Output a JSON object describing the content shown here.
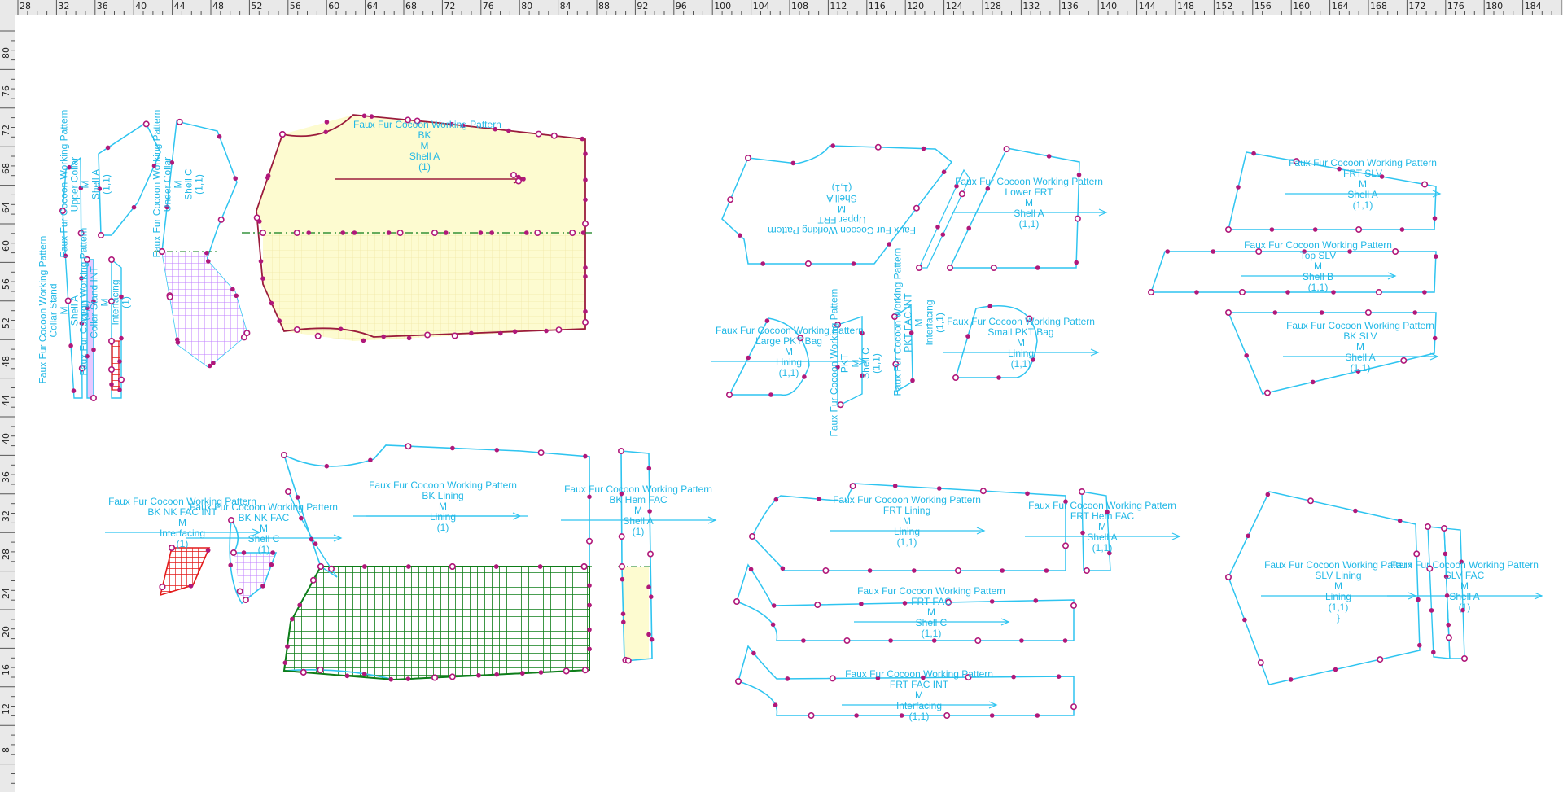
{
  "colors": {
    "outline": "#2ec4f0",
    "outline_shell": "#9b1c3c",
    "point": "#b0187a",
    "label": "#21b8e6",
    "yellow_fill": "#fdfbd0",
    "lavender_fill": "#e6c8ff",
    "green_grid": "#0e7d18",
    "red_grid": "#e31b1b",
    "ruler_bg": "#e9e9e9"
  },
  "ruler": {
    "top_labels": [
      "28",
      "32",
      "36",
      "40",
      "44",
      "48",
      "52",
      "56",
      "60",
      "64",
      "68",
      "72",
      "76",
      "80",
      "84",
      "88",
      "92",
      "96",
      "100",
      "104",
      "108",
      "112",
      "116",
      "120",
      "124",
      "128",
      "132",
      "136",
      "140",
      "144",
      "148",
      "152",
      "156",
      "160",
      "164",
      "168",
      "172",
      "176",
      "180",
      "184"
    ],
    "left_labels": [
      "80",
      "76",
      "72",
      "68",
      "64",
      "60",
      "56",
      "52",
      "48",
      "44",
      "40",
      "36",
      "32",
      "28",
      "24",
      "20",
      "16",
      "12",
      "8"
    ]
  },
  "pieces": [
    {
      "id": "bk",
      "lines": [
        "Faux Fur Cocoon Working Pattern",
        "BK",
        "M",
        "Shell A",
        "(1)"
      ]
    },
    {
      "id": "upper-frt",
      "lines": [
        "Faux Fur Cocoon Working Pattern",
        "Upper FRT",
        "M",
        "Shell A",
        "(1,1)"
      ]
    },
    {
      "id": "lower-frt",
      "lines": [
        "Faux Fur Cocoon Working Pattern",
        "Lower FRT",
        "M",
        "Shell A",
        "(1,1)"
      ]
    },
    {
      "id": "frt-slv",
      "lines": [
        "Faux Fur Cocoon Working Pattern",
        "FRT SLV",
        "M",
        "Shell A",
        "(1,1)"
      ]
    },
    {
      "id": "top-slv",
      "lines": [
        "Faux Fur Cocoon Working Pattern",
        "Top SLV",
        "M",
        "Shell B",
        "(1,1)"
      ]
    },
    {
      "id": "bk-slv",
      "lines": [
        "Faux Fur Cocoon Working Pattern",
        "BK SLV",
        "M",
        "Shell A",
        "(1,1)"
      ]
    },
    {
      "id": "large-pkt-bag",
      "lines": [
        "Faux Fur Cocoon Working Pattern",
        "Large PKT Bag",
        "M",
        "Lining",
        "(1,1)"
      ]
    },
    {
      "id": "small-pkt-bag",
      "lines": [
        "Faux Fur Cocoon Working Pattern",
        "Small PKT Bag",
        "M",
        "Lining",
        "(1,1)"
      ]
    },
    {
      "id": "pkt-welt",
      "lines": [
        "Faux Fur Cocoon Working Pattern",
        "PKT",
        "M",
        "Shell C",
        "(1,1)"
      ]
    },
    {
      "id": "pkt-fac-int",
      "lines": [
        "Faux Fur Cocoon Working Pattern",
        "PKT FAC INT",
        "M",
        "Interfacing",
        "(1,1)"
      ]
    },
    {
      "id": "collar-stand",
      "lines": [
        "Faux Fur Cocoon Working Pattern",
        "Collar Stand",
        "M",
        "Shell A",
        "(1,1)"
      ]
    },
    {
      "id": "upper-collar",
      "lines": [
        "Faux Fur Cocoon Working Pattern",
        "Upper Collar",
        "M",
        "Shell A",
        "(1,1)"
      ]
    },
    {
      "id": "collar-stand-int",
      "lines": [
        "Faux Fur Cocoon Working Pattern",
        "Collar Stand INT",
        "M",
        "Interfacing",
        "(1)"
      ]
    },
    {
      "id": "under-collar",
      "lines": [
        "Faux Fur Cocoon Working Pattern",
        "Under Collar",
        "M",
        "Shell C",
        "(1,1)"
      ]
    },
    {
      "id": "bk-lining",
      "lines": [
        "Faux Fur Cocoon Working Pattern",
        "BK Lining",
        "M",
        "Lining",
        "(1)"
      ]
    },
    {
      "id": "bk-hem-fac",
      "lines": [
        "Faux Fur Cocoon Working Pattern",
        "BK Hem FAC",
        "M",
        "Shell A",
        "(1)"
      ]
    },
    {
      "id": "bk-nk-fac-int",
      "lines": [
        "Faux Fur Cocoon Working Pattern",
        "BK NK FAC INT",
        "M",
        "Interfacing",
        "(1)"
      ]
    },
    {
      "id": "bk-nk-fac",
      "lines": [
        "Faux Fur Cocoon Working Pattern",
        "BK NK FAC",
        "M",
        "Shell C",
        "(1)"
      ]
    },
    {
      "id": "frt-lining",
      "lines": [
        "Faux Fur Cocoon Working Pattern",
        "FRT Lining",
        "M",
        "Lining",
        "(1,1)"
      ]
    },
    {
      "id": "frt-hem-fac",
      "lines": [
        "Faux Fur Cocoon Working Pattern",
        "FRT Hem FAC",
        "M",
        "Shell A",
        "(1,1)"
      ]
    },
    {
      "id": "frt-fac",
      "lines": [
        "Faux Fur Cocoon Working Pattern",
        "FRT FAC",
        "M",
        "Shell C",
        "(1,1)"
      ]
    },
    {
      "id": "frt-fac-int",
      "lines": [
        "Faux Fur Cocoon Working Pattern",
        "FRT FAC INT",
        "M",
        "Interfacing",
        "(1,1)"
      ]
    },
    {
      "id": "slv-lining",
      "lines": [
        "Faux Fur Cocoon Working Pattern",
        "SLV Lining",
        "M",
        "Lining",
        "(1,1)"
      ]
    },
    {
      "id": "slv-fac",
      "lines": [
        "Faux Fur Cocoon Working Pattern",
        "SLV FAC",
        "M",
        "Shell A",
        "(1)"
      ]
    }
  ]
}
